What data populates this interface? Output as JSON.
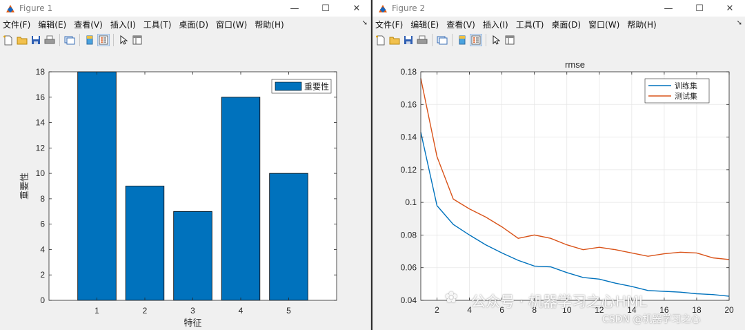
{
  "menu": [
    "文件(F)",
    "编辑(E)",
    "查看(V)",
    "插入(I)",
    "工具(T)",
    "桌面(D)",
    "窗口(W)",
    "帮助(H)"
  ],
  "window_controls": {
    "minimize": "—",
    "maximize": "☐",
    "close": "✕"
  },
  "figure1": {
    "title": "Figure 1",
    "chart_data": {
      "type": "bar",
      "categories": [
        "1",
        "2",
        "3",
        "4",
        "5"
      ],
      "values": [
        18,
        9,
        7,
        16,
        10
      ],
      "series_name": "重要性",
      "xlabel": "特征",
      "ylabel": "重要性",
      "xlim": [
        0,
        6
      ],
      "ylim": [
        0,
        18
      ],
      "yticks": [
        0,
        2,
        4,
        6,
        8,
        10,
        12,
        14,
        16,
        18
      ],
      "color": "#0072BD",
      "legend": "top-right",
      "grid": false
    }
  },
  "figure2": {
    "title": "Figure 2",
    "chart_data": {
      "type": "line",
      "title": "rmse",
      "x": [
        1,
        2,
        3,
        4,
        5,
        6,
        7,
        8,
        9,
        10,
        11,
        12,
        13,
        14,
        15,
        16,
        17,
        18,
        19,
        20
      ],
      "series": [
        {
          "name": "训练集",
          "color": "#0072BD",
          "values": [
            0.143,
            0.098,
            0.0865,
            0.08,
            0.074,
            0.069,
            0.0645,
            0.061,
            0.0605,
            0.057,
            0.054,
            0.053,
            0.0505,
            0.0485,
            0.046,
            0.0455,
            0.045,
            0.044,
            0.0435,
            0.0425
          ]
        },
        {
          "name": "测试集",
          "color": "#D95319",
          "values": [
            0.176,
            0.128,
            0.102,
            0.096,
            0.091,
            0.085,
            0.078,
            0.08,
            0.078,
            0.074,
            0.071,
            0.0725,
            0.071,
            0.069,
            0.067,
            0.0685,
            0.0695,
            0.069,
            0.066,
            0.065
          ]
        }
      ],
      "xlim": [
        1,
        20
      ],
      "ylim": [
        0.04,
        0.18
      ],
      "xticks": [
        2,
        4,
        6,
        8,
        10,
        12,
        14,
        16,
        18,
        20
      ],
      "yticks": [
        0.04,
        0.06,
        0.08,
        0.1,
        0.12,
        0.14,
        0.16,
        0.18
      ],
      "legend": "top-right",
      "grid": true
    }
  },
  "watermark": {
    "main": "公众号 · 机器学习之心HML",
    "sub": "CSDN @机器学习之心"
  }
}
